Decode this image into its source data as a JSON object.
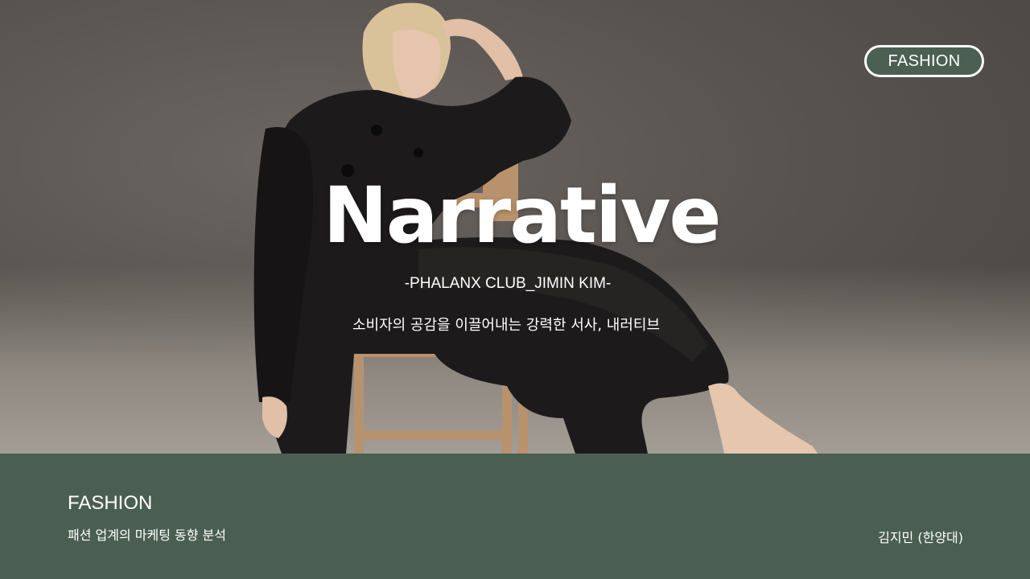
{
  "badge": {
    "label": "FASHION"
  },
  "hero": {
    "title": "Narrative",
    "subtitle": "-PHALANX CLUB_JIMIN KIM-",
    "tagline": "소비자의 공감을 이끌어내는 강력한 서사, 내러티브"
  },
  "footer": {
    "category": "FASHION",
    "description": "패션 업계의 마케팅 동향 분석",
    "author": "김지민 (한양대)"
  },
  "colors": {
    "accent": "#4a5f52",
    "text": "#ffffff"
  }
}
